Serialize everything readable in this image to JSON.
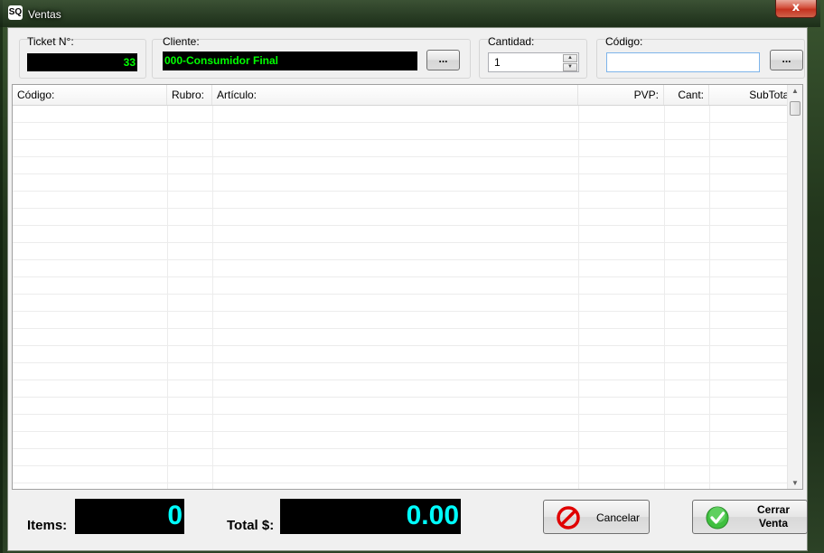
{
  "window": {
    "app_icon_text": "SQ",
    "title": "Ventas",
    "close_symbol": "x"
  },
  "ticket": {
    "label": "Ticket N°:",
    "value": "33"
  },
  "cliente": {
    "label": "Cliente:",
    "value": "000-Consumidor Final",
    "browse_label": "..."
  },
  "cantidad": {
    "label": "Cantidad:",
    "value": "1"
  },
  "codigo": {
    "label": "Código:",
    "value": "",
    "browse_label": "..."
  },
  "grid": {
    "columns": [
      "Código:",
      "Rubro:",
      "Artículo:",
      "PVP:",
      "Cant:",
      "SubTotal"
    ],
    "rows": []
  },
  "footer": {
    "items_label": "Items:",
    "items_value": "0",
    "total_label": "Total $:",
    "total_value": "0.00",
    "cancel_label": "Cancelar",
    "close_sale_line1": "Cerrar",
    "close_sale_line2": "Venta"
  },
  "colors": {
    "lcd_background": "#000000",
    "lcd_text": "#00ffff",
    "green_text": "#00ff00",
    "cancel_icon": "#e00000",
    "confirm_icon": "#33b533"
  },
  "icons": {
    "cancel": "no-entry-icon",
    "confirm": "check-circle-icon"
  }
}
